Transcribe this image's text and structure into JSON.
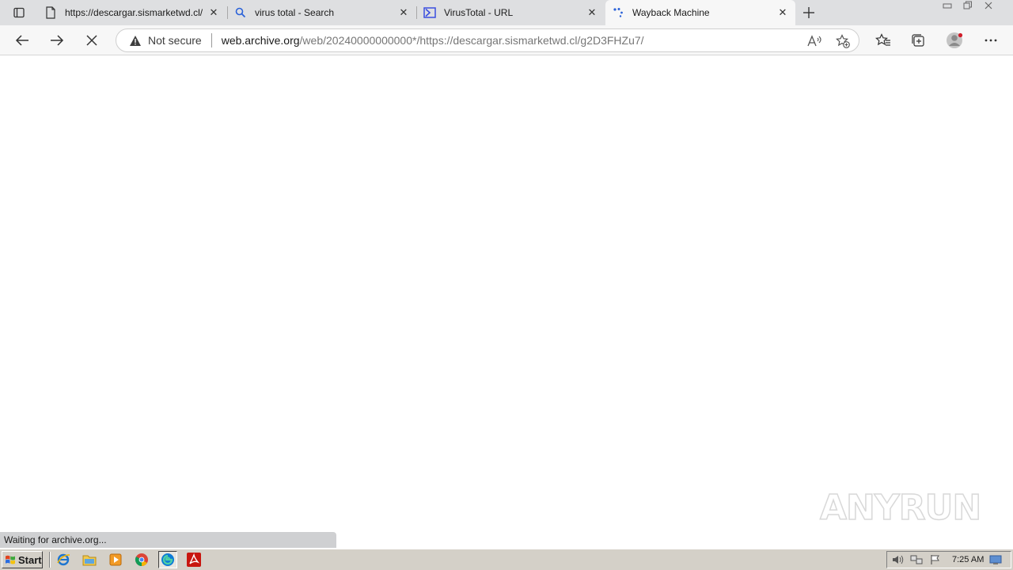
{
  "tabs": [
    {
      "title": "https://descargar.sismarketwd.cl/",
      "favicon": "page-icon"
    },
    {
      "title": "virus total - Search",
      "favicon": "search-icon"
    },
    {
      "title": "VirusTotal - URL",
      "favicon": "virustotal-icon"
    },
    {
      "title": "Wayback Machine",
      "favicon": "loading-spinner-icon"
    }
  ],
  "address_bar": {
    "security_label": "Not secure",
    "url_host": "web.archive.org",
    "url_rest": "/web/20240000000000*/https://descargar.sismarketwd.cl/g2D3FHZu7/"
  },
  "status": {
    "text": "Waiting for archive.org..."
  },
  "watermark": {
    "left": "ANY",
    "right": "RUN"
  },
  "taskbar": {
    "start_label": "Start",
    "clock": "7:25 AM"
  },
  "colors": {
    "tabstrip": "#dedfe1",
    "toolbar": "#f7f7f7",
    "taskbar": "#d4d0c8",
    "virustotal_blue": "#3a4ee0",
    "edge_blue": "#0d7bd6",
    "pdf_red": "#c8160f"
  }
}
